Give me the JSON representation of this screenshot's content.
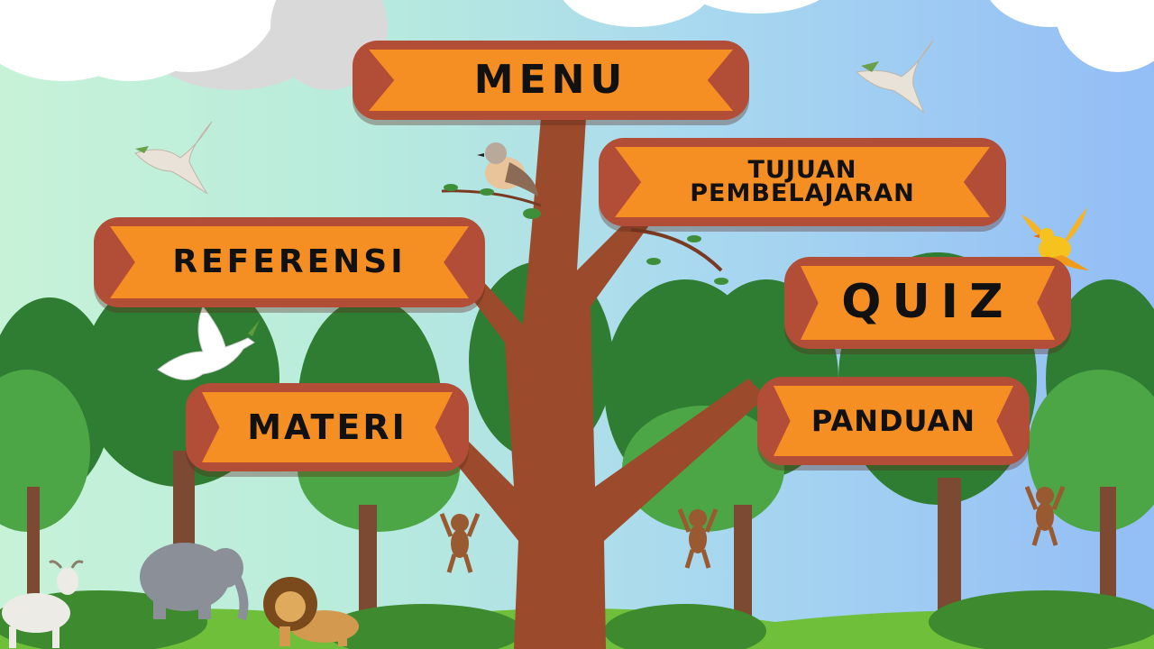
{
  "menu": {
    "title": "MENU",
    "buttons": {
      "tujuan": "TUJUAN PEMBELAJARAN",
      "referensi": "REFERENSI",
      "quiz": "QUIZ",
      "materi": "MATERI",
      "panduan": "PANDUAN"
    }
  },
  "colors": {
    "sign_border": "#b24d37",
    "sign_fill": "#f58f24",
    "trunk": "#9c4a2c",
    "leaf": "#3f8f3a",
    "grass": "#6fbf3a"
  },
  "icons": [
    "dove-icon",
    "sparrow-icon",
    "yellow-bird-icon",
    "monkey-icon",
    "goat-icon",
    "elephant-icon",
    "lion-icon",
    "tree-icon",
    "cloud-icon"
  ]
}
